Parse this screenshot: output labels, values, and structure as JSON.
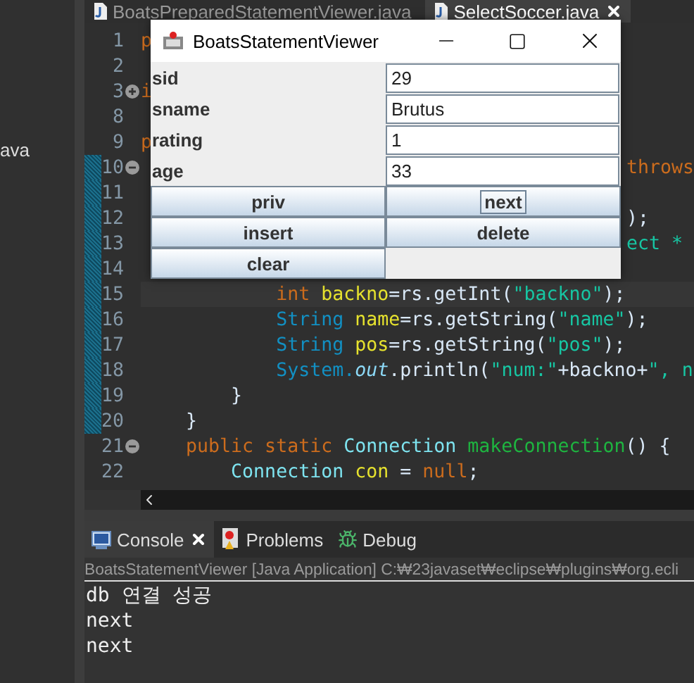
{
  "sidebar": {
    "items": [
      "ava"
    ]
  },
  "editor": {
    "tabs": [
      {
        "label": "BoatsPreparedStatementViewer.java",
        "selected": false,
        "closable": false
      },
      {
        "label": "SelectSoccer.java",
        "selected": true,
        "closable": true
      }
    ],
    "lines": [
      {
        "number": "1",
        "changed": false,
        "current": false,
        "left": [
          {
            "text": "p",
            "kind": "keyword"
          }
        ]
      },
      {
        "number": "2",
        "changed": false,
        "current": false
      },
      {
        "number": "3",
        "collapsed": true,
        "changed": false,
        "current": false,
        "left": [
          {
            "text": "i",
            "kind": "keyword"
          }
        ]
      },
      {
        "number": "8",
        "changed": false,
        "current": false
      },
      {
        "number": "9",
        "changed": false,
        "current": false,
        "left": [
          {
            "text": "p",
            "kind": "keyword"
          }
        ]
      },
      {
        "number": "10",
        "collapsed": false,
        "changed": true,
        "current": false,
        "right": [
          {
            "text": "throws",
            "kind": "keyword"
          }
        ]
      },
      {
        "number": "11",
        "changed": true,
        "current": false
      },
      {
        "number": "12",
        "changed": true,
        "current": false,
        "right": [
          {
            "text": ");",
            "kind": "plain"
          }
        ]
      },
      {
        "number": "13",
        "changed": true,
        "current": false,
        "right": [
          {
            "text": "ect *",
            "kind": "string"
          }
        ]
      },
      {
        "number": "14",
        "changed": true,
        "current": false
      },
      {
        "number": "15",
        "changed": true,
        "current": true,
        "left": [
          {
            "text": "            int",
            "kind": "keyword"
          },
          {
            "text": " backno",
            "kind": "variable"
          },
          {
            "text": "=rs.getInt(",
            "kind": "plain"
          },
          {
            "text": "\"backno\"",
            "kind": "string"
          },
          {
            "text": ");",
            "kind": "plain"
          }
        ]
      },
      {
        "number": "16",
        "changed": true,
        "current": false,
        "left": [
          {
            "text": "            String",
            "kind": "type"
          },
          {
            "text": " name",
            "kind": "variable"
          },
          {
            "text": "=rs.getString(",
            "kind": "plain"
          },
          {
            "text": "\"name\"",
            "kind": "string"
          },
          {
            "text": ");",
            "kind": "plain"
          }
        ]
      },
      {
        "number": "17",
        "changed": true,
        "current": false,
        "left": [
          {
            "text": "            String",
            "kind": "type"
          },
          {
            "text": " pos",
            "kind": "variable"
          },
          {
            "text": "=rs.getString(",
            "kind": "plain"
          },
          {
            "text": "\"pos\"",
            "kind": "string"
          },
          {
            "text": ");",
            "kind": "plain"
          }
        ]
      },
      {
        "number": "18",
        "changed": true,
        "current": false,
        "left": [
          {
            "text": "            System.",
            "kind": "type"
          },
          {
            "text": "out",
            "kind": "field"
          },
          {
            "text": ".println(",
            "kind": "plain"
          },
          {
            "text": "\"num:\"",
            "kind": "string"
          },
          {
            "text": "+backno+",
            "kind": "plain"
          },
          {
            "text": "\", n",
            "kind": "string"
          }
        ]
      },
      {
        "number": "19",
        "changed": true,
        "current": false,
        "left": [
          {
            "text": "        }",
            "kind": "plain"
          }
        ]
      },
      {
        "number": "20",
        "changed": true,
        "current": false,
        "left": [
          {
            "text": "    }",
            "kind": "plain"
          }
        ]
      },
      {
        "number": "21",
        "collapsed": false,
        "changed": false,
        "current": false,
        "left": [
          {
            "text": "    public static",
            "kind": "keyword"
          },
          {
            "text": " Connection",
            "kind": "class"
          },
          {
            "text": " makeConnection",
            "kind": "method"
          },
          {
            "text": "() {",
            "kind": "plain"
          }
        ]
      },
      {
        "number": "22",
        "changed": false,
        "current": false,
        "left": [
          {
            "text": "        Connection",
            "kind": "class"
          },
          {
            "text": " con",
            "kind": "variable"
          },
          {
            "text": " = ",
            "kind": "plain"
          },
          {
            "text": "null",
            "kind": "keyword"
          },
          {
            "text": ";",
            "kind": "plain"
          }
        ]
      }
    ]
  },
  "dialog": {
    "title": "BoatsStatementViewer",
    "fields": [
      {
        "label": "sid",
        "value": "29"
      },
      {
        "label": "sname",
        "value": "Brutus"
      },
      {
        "label": "rating",
        "value": "1"
      },
      {
        "label": "age",
        "value": "33"
      }
    ],
    "buttons": [
      {
        "label": "priv",
        "focused": false
      },
      {
        "label": "next",
        "focused": true
      },
      {
        "label": "insert",
        "focused": false
      },
      {
        "label": "delete",
        "focused": false
      },
      {
        "label": "clear",
        "focused": false
      }
    ]
  },
  "console": {
    "tabs": [
      {
        "label": "Console",
        "selected": true,
        "closable": true,
        "kind": "console"
      },
      {
        "label": "Problems",
        "selected": false,
        "closable": false,
        "kind": "problems"
      },
      {
        "label": "Debug",
        "selected": false,
        "closable": false,
        "kind": "debug"
      }
    ],
    "launch": "BoatsStatementViewer [Java Application] C:₩23javaset₩eclipse₩plugins₩org.ecli",
    "output": [
      "db 연결 성공",
      "next",
      "next"
    ]
  }
}
